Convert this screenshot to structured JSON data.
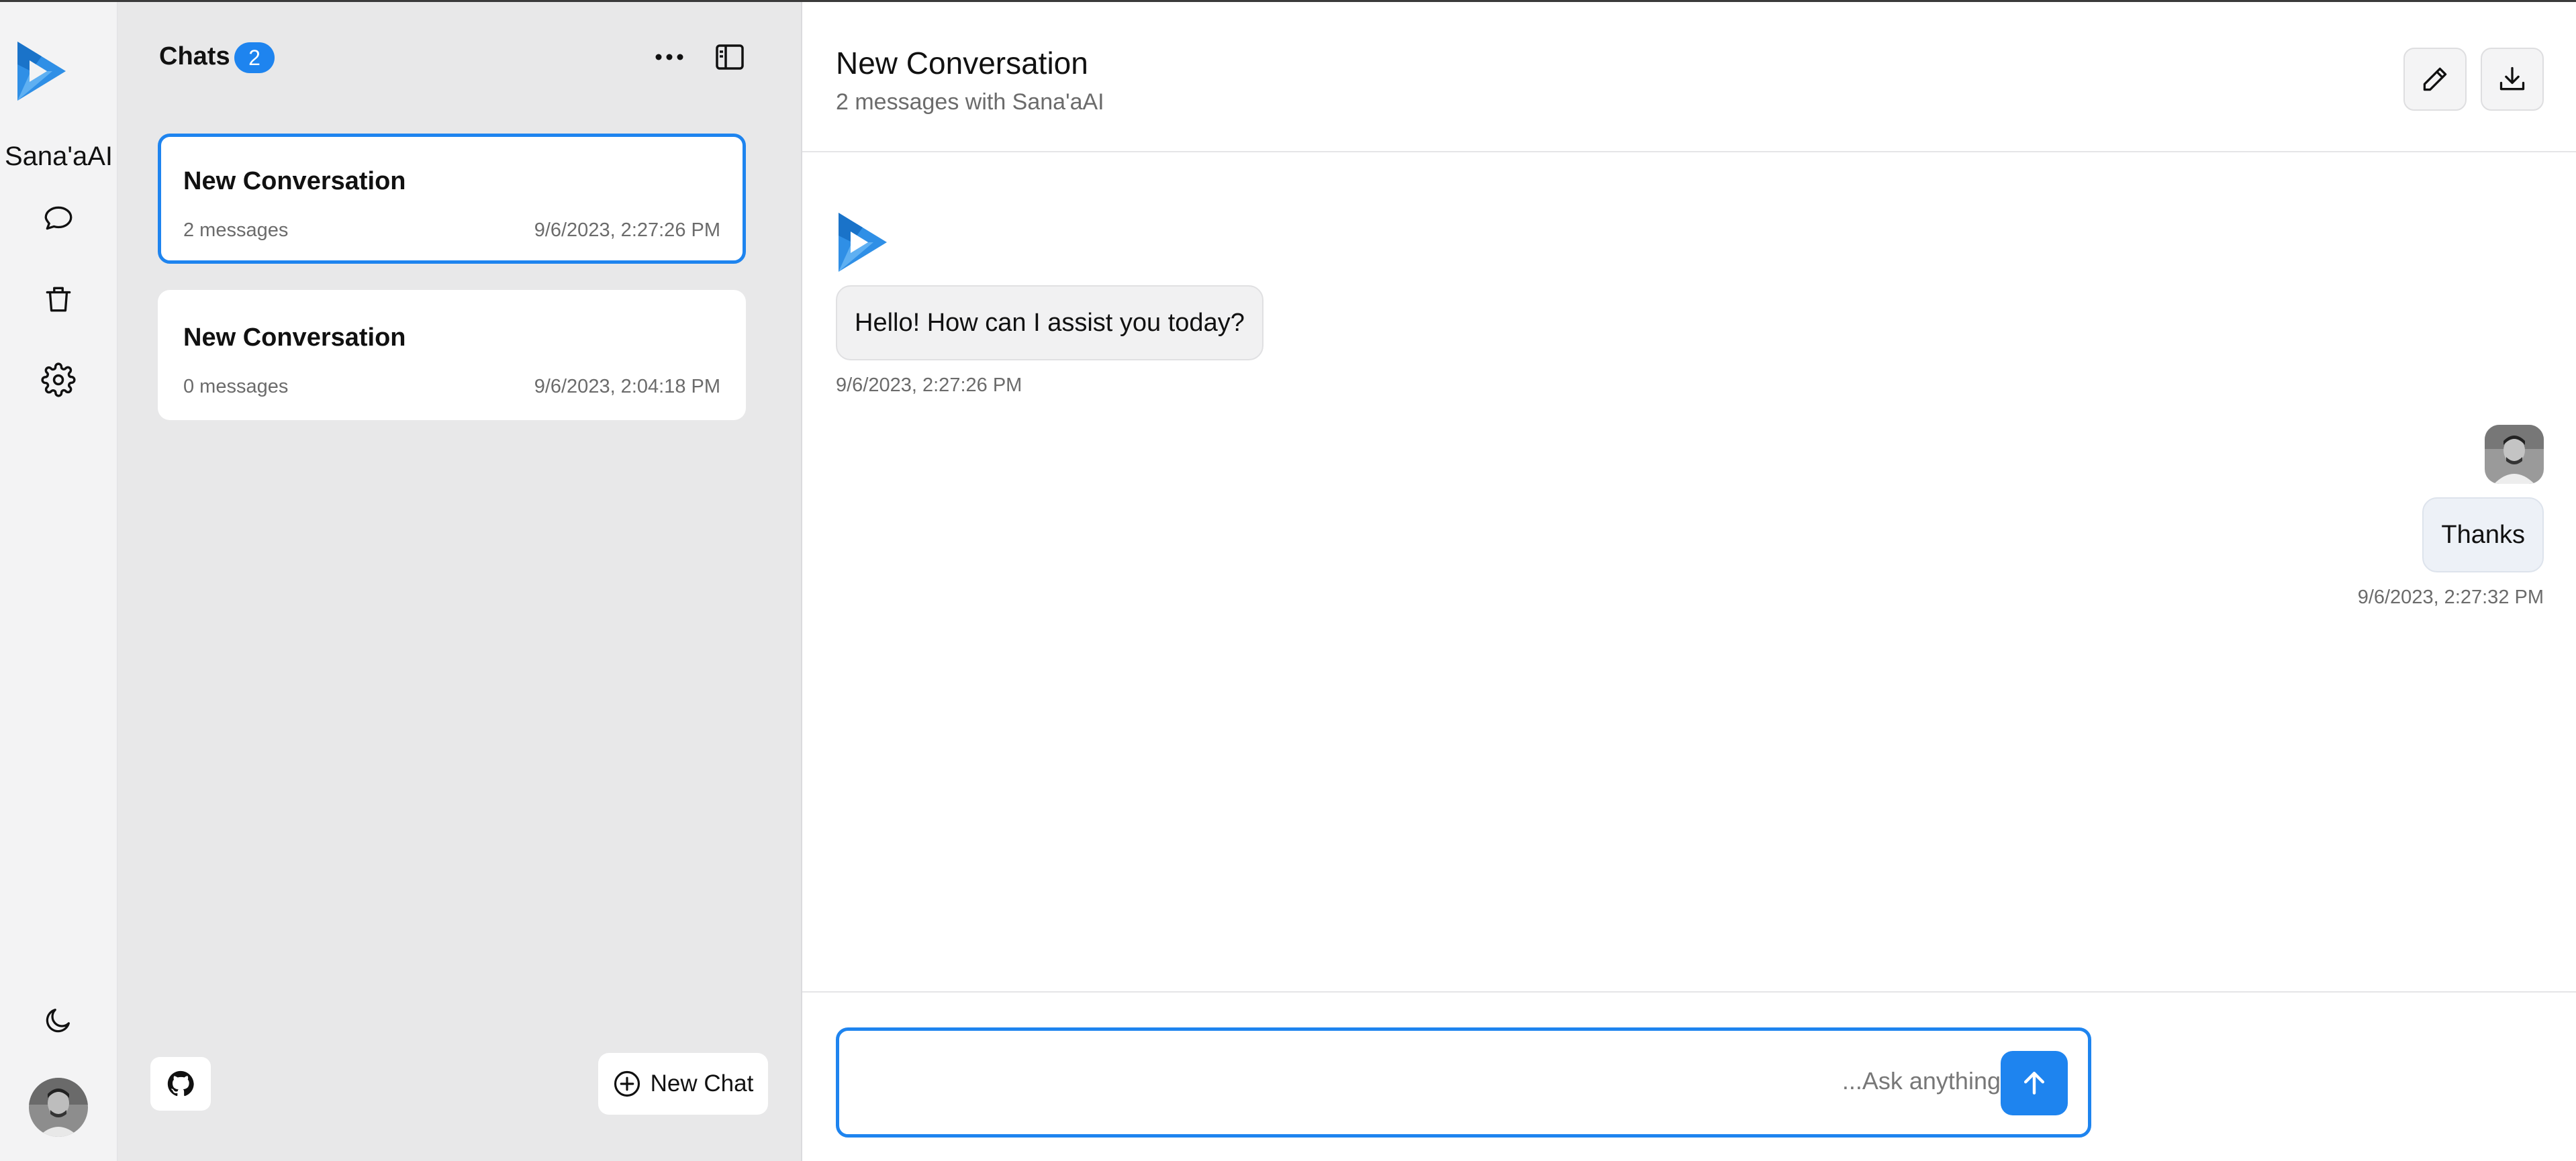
{
  "app": {
    "brand_name": "Sana'aAI",
    "accent_color": "#1e84ef"
  },
  "rail": {
    "items": [
      {
        "icon": "chat-bubble-icon"
      },
      {
        "icon": "trash-icon"
      },
      {
        "icon": "gear-icon"
      }
    ],
    "bottom": {
      "theme_icon": "moon-icon",
      "avatar": "user-avatar"
    }
  },
  "chats_panel": {
    "title": "Chats",
    "count": "2",
    "more_icon": "more-horizontal-icon",
    "sidebar_toggle_icon": "sidebar-toggle-icon",
    "conversations": [
      {
        "title": "New Conversation",
        "messages": "2 messages",
        "date": "9/6/2023, 2:27:26 PM",
        "active": true
      },
      {
        "title": "New Conversation",
        "messages": "0 messages",
        "date": "9/6/2023, 2:04:18 PM",
        "active": false
      }
    ],
    "github_icon": "github-icon",
    "new_chat_label": "New Chat"
  },
  "main": {
    "title": "New Conversation",
    "subtitle": "2 messages with Sana'aAI",
    "edit_icon": "pencil-icon",
    "download_icon": "download-icon",
    "messages": [
      {
        "role": "assistant",
        "text": "Hello! How can I assist you today?",
        "time": "9/6/2023, 2:27:26 PM"
      },
      {
        "role": "user",
        "text": "Thanks",
        "time": "9/6/2023, 2:27:32 PM"
      }
    ],
    "composer": {
      "placeholder": "...Ask anything",
      "value": "",
      "send_icon": "arrow-up-icon"
    }
  }
}
